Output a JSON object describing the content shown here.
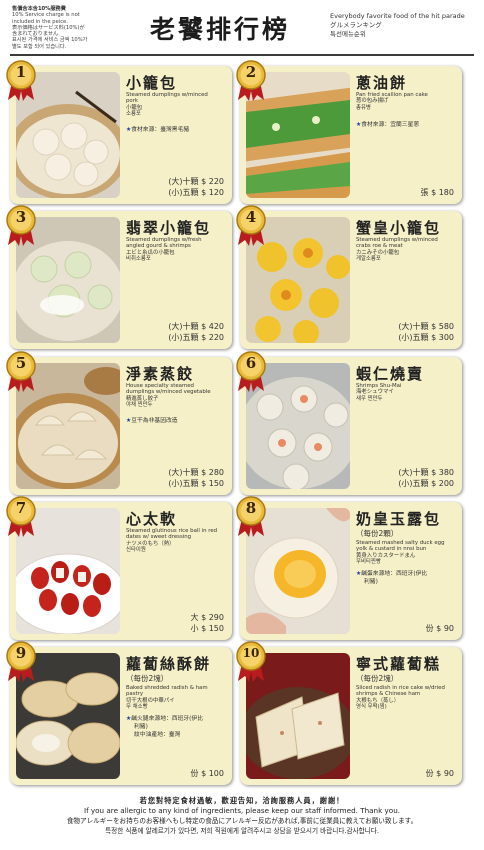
{
  "header": {
    "notice_lines": [
      "售價含本含10%服務費",
      "10% Service charge is not",
      "included in the peice.",
      "表示価格はサービス料(10%)が",
      "含まれておりません",
      "표시된 가격에 서비스 금액 10%가",
      "별도 포함 되어 있습니다."
    ],
    "title": "老饕排行榜",
    "subtitle_lines": [
      "Everybody favorite food of the hit parade",
      "グルメランキング",
      "특선메뉴순위"
    ]
  },
  "items": [
    {
      "rank": "1",
      "name": "小籠包",
      "desc_lines": [
        "Steamed dumplings w/minced",
        "pork",
        "小籠包",
        "소룡포"
      ],
      "origin_lines": [
        "食材來源：臺灣黑毛豬"
      ],
      "prices": [
        "(大)十顆 $ 220",
        "(小)五顆 $ 120"
      ]
    },
    {
      "rank": "2",
      "name": "蔥油餅",
      "desc_lines": [
        "Pan fried scallion pan cake",
        "葱の包み揚げ",
        "총유병"
      ],
      "origin_lines": [
        "食材來源：宜蘭三星蔥"
      ],
      "prices": [
        "張 $ 180"
      ]
    },
    {
      "rank": "3",
      "name": "翡翠小籠包",
      "desc_lines": [
        "Steamed dumplings w/fresh",
        "angled gourd & shrimps",
        "エビと糸瓜の小籠包",
        "비취소룡포"
      ],
      "origin_lines": [],
      "prices": [
        "(大)十顆 $ 420",
        "(小)五顆 $ 220"
      ]
    },
    {
      "rank": "4",
      "name": "蟹皇小籠包",
      "desc_lines": [
        "Steamed dumplings w/minced",
        "crabs roe & meat",
        "カニみその小籠包",
        "게알소룡포"
      ],
      "origin_lines": [],
      "prices": [
        "(大)十顆 $ 580",
        "(小)五顆 $ 300"
      ]
    },
    {
      "rank": "5",
      "name": "淨素蒸餃",
      "desc_lines": [
        "House specialty steamed",
        "dumplings w/minced vegetable",
        "精進蒸し餃子",
        "야채 찐만두"
      ],
      "origin_lines": [
        "豆干為非基因改造"
      ],
      "prices": [
        "(大)十顆 $ 280",
        "(小)五顆 $ 150"
      ]
    },
    {
      "rank": "6",
      "name": "蝦仁燒賣",
      "desc_lines": [
        "Shrimps Shu-Mai",
        "海老シュウマイ",
        "새우 찐만두"
      ],
      "origin_lines": [],
      "prices": [
        "(大)十顆 $ 380",
        "(小)五顆 $ 200"
      ]
    },
    {
      "rank": "7",
      "name": "心太軟",
      "desc_lines": [
        "Steamed glutinous rice ball in red",
        "dates w/ sweet dressing",
        "ナツメのもち（熱）",
        "신타이원"
      ],
      "origin_lines": [],
      "prices": [
        "大 $ 290",
        "小 $ 150"
      ]
    },
    {
      "rank": "8",
      "name": "奶皇玉露包",
      "pieces": "（每份2顆）",
      "desc_lines": [
        "Steamed mashed salty duck egg",
        "yolk & custard in nnsi bun",
        "黄身入りカスタードまん",
        "우비티찐빵"
      ],
      "origin_lines": [
        "鹹蛋來源地：西班牙(伊比",
        "利豬)"
      ],
      "prices": [
        "份 $ 90"
      ]
    },
    {
      "rank": "9",
      "name": "蘿蔔絲酥餅",
      "pieces": "（每份2塊）",
      "desc_lines": [
        "Baked shredded radish & ham",
        "pastry",
        "切干大根の中華パイ",
        "무 채소빵"
      ],
      "origin_lines": [
        "鹹火腿來源地：西班牙(伊比",
        "利豬)",
        "紋中油產地：臺灣"
      ],
      "prices": [
        "份 $ 100"
      ]
    },
    {
      "rank": "10",
      "name": "寧式蘿蔔糕",
      "pieces": "（每份2塊）",
      "desc_lines": [
        "Sliced radish in rice cake w/dried",
        "shrimps & Chinese ham",
        "大根もち（蒸し）",
        "영식 무떡(찜)"
      ],
      "origin_lines": [],
      "prices": [
        "份 $ 90"
      ]
    }
  ],
  "footer": {
    "lines": [
      "若您對特定食材過敏，歡迎告知，洽詢服務人員，謝謝！",
      "If you are allergic to any kind of ingredients, please keep our staff informed. Thank you.",
      "食物アレルギーをお持ちのお客様へもし特定の食品にアレルギー反応があれば,事前に従業員に教えてお願い致します。",
      "특정한 식품에 알레르기가 있다면, 저희 직원에게 알려주시고 상담을 받으시기 바랍니다.감사합니다."
    ]
  },
  "colors": {
    "card_bg": "#f6f0c8",
    "medal_gold": "#e9b93a",
    "ribbon_red": "#b81c1c",
    "origin_star": "#1a3f9c"
  }
}
